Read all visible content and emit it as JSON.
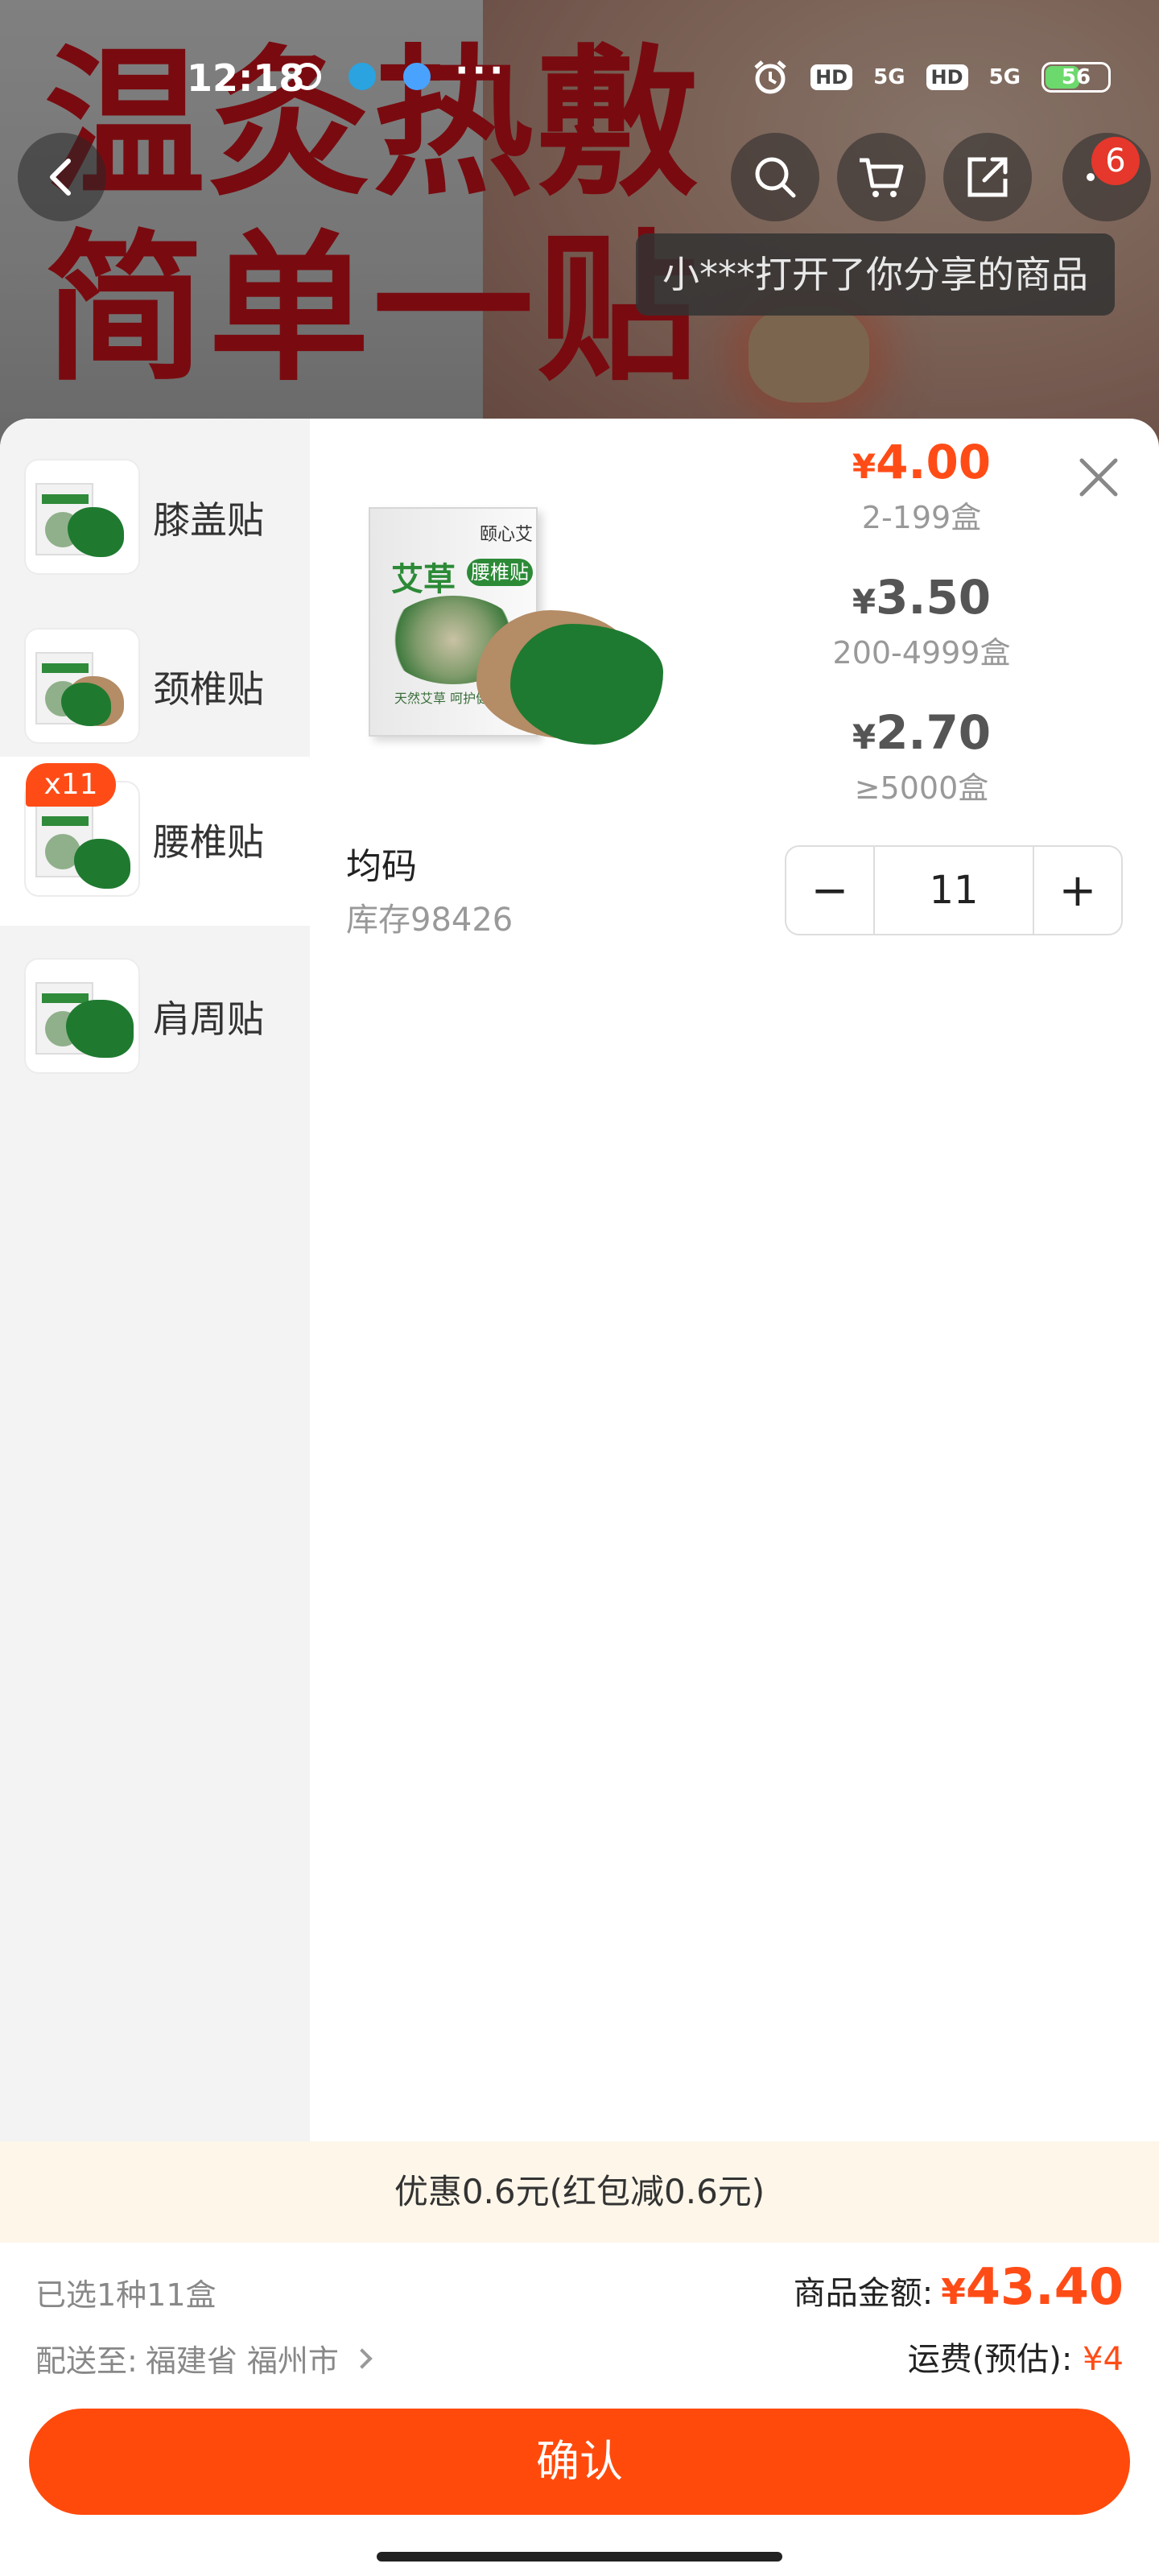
{
  "status_bar": {
    "time": "12:18",
    "more": "···",
    "hd1": "HD",
    "net1": "5G",
    "hd2": "HD",
    "net2": "5G",
    "battery": "56"
  },
  "hero": {
    "headline_line1": "温灸热敷",
    "headline_line2": "简单一贴"
  },
  "nav": {
    "notification_count": "6",
    "toast": "小***打开了你分享的商品"
  },
  "sidebar": {
    "items": [
      {
        "label": "膝盖贴",
        "active": false
      },
      {
        "label": "颈椎贴",
        "active": false
      },
      {
        "label": "腰椎贴",
        "active": true,
        "qty_tag": "x11"
      },
      {
        "label": "肩周贴",
        "active": false
      }
    ]
  },
  "product": {
    "box_brand": "颐心艾",
    "box_title": "艾草",
    "box_title_badge": "腰椎贴",
    "box_small_text": "天然艾草 呵护健康"
  },
  "price_tiers": [
    {
      "currency": "¥",
      "price": "4.00",
      "range": "2-199盒"
    },
    {
      "currency": "¥",
      "price": "3.50",
      "range": "200-4999盒"
    },
    {
      "currency": "¥",
      "price": "2.70",
      "range": "≥5000盒"
    }
  ],
  "spec": {
    "name": "均码",
    "stock": "库存98426"
  },
  "stepper": {
    "minus": "−",
    "value": "11",
    "plus": "+"
  },
  "promo": "优惠0.6元(红包减0.6元)",
  "summary": {
    "selected": "已选1种11盒",
    "ship_to_label": "配送至:",
    "ship_to_value": "福建省 福州市",
    "total_label": "商品金额:",
    "total_currency": "¥",
    "total_amount": "43.40",
    "freight_label": "运费(预估):",
    "freight_value": "¥4"
  },
  "confirm_label": "确认",
  "colors": {
    "accent": "#ff4c17",
    "button": "#ff4a0c",
    "promo_bg": "#fdf6e9",
    "sidebar_bg": "#f3f3f3"
  }
}
